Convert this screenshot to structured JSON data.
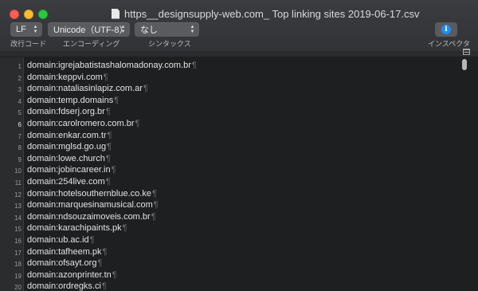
{
  "window": {
    "title": "https__designsupply-web.com_ Top linking sites 2019-06-17.csv"
  },
  "toolbar": {
    "line_ending": {
      "value": "LF",
      "label": "改行コード"
    },
    "encoding": {
      "value": "Unicode（UTF-8）",
      "label": "エンコーディング"
    },
    "syntax": {
      "value": "なし",
      "label": "シンタックス"
    },
    "inspector": {
      "label": "インスペクタ",
      "icon": "info-icon"
    }
  },
  "editor": {
    "current_line": 6,
    "pilcrow": "¶",
    "lines": [
      {
        "num": "1",
        "text": "domain:igrejabatistashalomadonay.com.br"
      },
      {
        "num": "2",
        "text": "domain:keppvi.com"
      },
      {
        "num": "3",
        "text": "domain:nataliasinlapiz.com.ar"
      },
      {
        "num": "4",
        "text": "domain:temp.domains"
      },
      {
        "num": "5",
        "text": "domain:fdserj.org.br"
      },
      {
        "num": "6",
        "text": "domain:carolromero.com.br"
      },
      {
        "num": "7",
        "text": "domain:enkar.com.tr"
      },
      {
        "num": "8",
        "text": "domain:mglsd.go.ug"
      },
      {
        "num": "9",
        "text": "domain:lowe.church"
      },
      {
        "num": "10",
        "text": "domain:jobincareer.in"
      },
      {
        "num": "11",
        "text": "domain:254live.com"
      },
      {
        "num": "12",
        "text": "domain:hotelsouthernblue.co.ke"
      },
      {
        "num": "13",
        "text": "domain:marquesinamusical.com"
      },
      {
        "num": "14",
        "text": "domain:ndsouzaimoveis.com.br"
      },
      {
        "num": "15",
        "text": "domain:karachipaints.pk"
      },
      {
        "num": "16",
        "text": "domain:ub.ac.id"
      },
      {
        "num": "17",
        "text": "domain:tafheem.pk"
      },
      {
        "num": "18",
        "text": "domain:ofsayt.org"
      },
      {
        "num": "19",
        "text": "domain:azonprinter.tn"
      },
      {
        "num": "20",
        "text": "domain:ordregks.ci"
      }
    ]
  }
}
